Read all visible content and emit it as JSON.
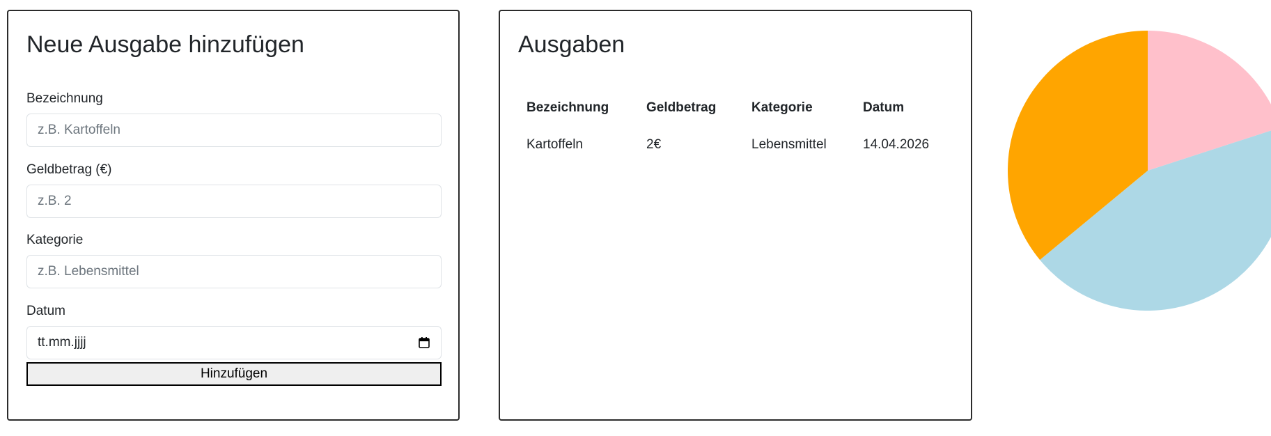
{
  "form": {
    "title": "Neue Ausgabe hinzufügen",
    "fields": [
      {
        "label": "Bezeichnung",
        "placeholder": "z.B. Kartoffeln",
        "value": ""
      },
      {
        "label": "Geldbetrag (€)",
        "placeholder": "z.B. 2",
        "value": ""
      },
      {
        "label": "Kategorie",
        "placeholder": "z.B. Lebensmittel",
        "value": ""
      },
      {
        "label": "Datum",
        "placeholder": "tt.mm.jjjj",
        "value": ""
      }
    ],
    "submit_label": "Hinzufügen"
  },
  "expenses": {
    "title": "Ausgaben",
    "columns": [
      "Bezeichnung",
      "Geldbetrag",
      "Kategorie",
      "Datum"
    ],
    "rows": [
      [
        "Kartoffeln",
        "2€",
        "Lebensmittel",
        "14.04.2026"
      ]
    ]
  },
  "chart_data": {
    "type": "pie",
    "slices": [
      {
        "value": 20,
        "color": "#ffc0cb"
      },
      {
        "value": 44,
        "color": "#add8e6"
      },
      {
        "value": 36,
        "color": "#ffa500"
      }
    ]
  }
}
